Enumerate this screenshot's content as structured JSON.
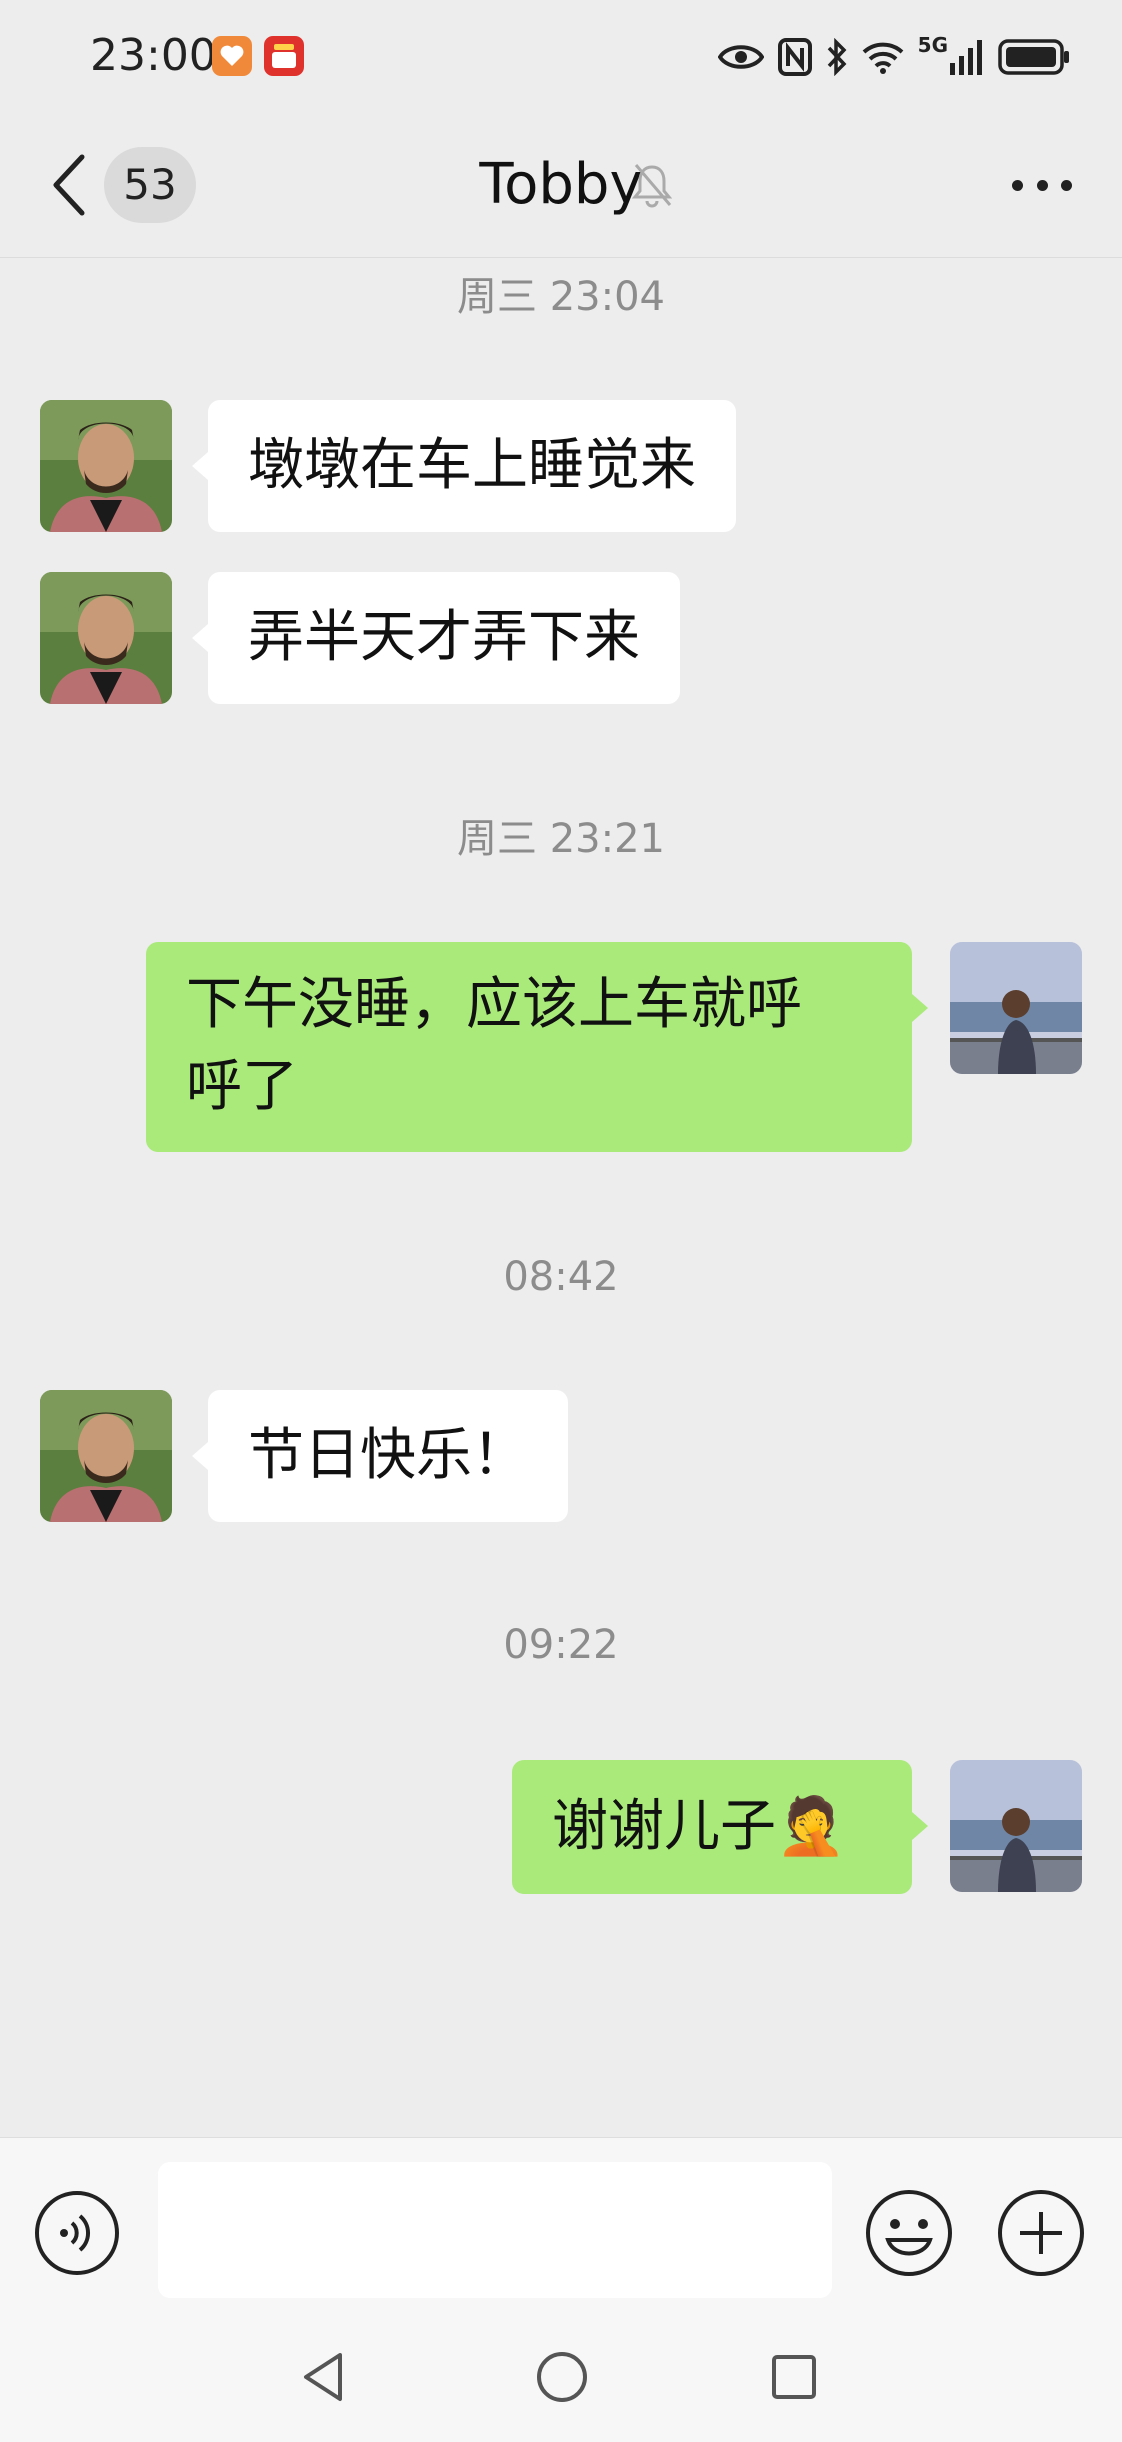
{
  "status_bar": {
    "time": "23:00",
    "network": "5G"
  },
  "header": {
    "unread_count": "53",
    "title": "Tobby"
  },
  "messages": [
    {
      "type": "timestamp",
      "text": "周三 23:04"
    },
    {
      "type": "incoming",
      "text": "墩墩在车上睡觉来"
    },
    {
      "type": "incoming",
      "text": "弄半天才弄下来"
    },
    {
      "type": "timestamp",
      "text": "周三 23:21"
    },
    {
      "type": "outgoing",
      "line1": "下午没睡，应该上车就呼",
      "line2": "呼了"
    },
    {
      "type": "timestamp",
      "text": "08:42"
    },
    {
      "type": "incoming",
      "text": "节日快乐！"
    },
    {
      "type": "timestamp",
      "text": "09:22"
    },
    {
      "type": "outgoing",
      "text": "谢谢儿子",
      "emoji": "🤦"
    }
  ],
  "colors": {
    "outgoing_bubble": "#a9ea7a",
    "incoming_bubble": "#ffffff",
    "background": "#ededed"
  },
  "icons": [
    "back-icon",
    "mute-bell-icon",
    "more-icon",
    "voice-icon",
    "emoji-icon",
    "plus-icon",
    "nav-back-icon",
    "nav-home-icon",
    "nav-recents-icon"
  ]
}
